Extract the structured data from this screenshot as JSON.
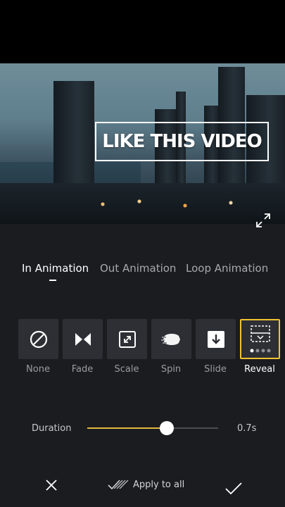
{
  "video": {
    "caption": "LIKE THIS VIDEO"
  },
  "tabs": [
    {
      "label": "In Animation",
      "active": true
    },
    {
      "label": "Out Animation",
      "active": false
    },
    {
      "label": "Loop Animation",
      "active": false
    }
  ],
  "animations": [
    {
      "label": "None",
      "icon": "none-icon",
      "selected": false
    },
    {
      "label": "Fade",
      "icon": "fade-icon",
      "selected": false
    },
    {
      "label": "Scale",
      "icon": "scale-icon",
      "selected": false
    },
    {
      "label": "Spin",
      "icon": "spin-icon",
      "selected": false
    },
    {
      "label": "Slide",
      "icon": "slide-icon",
      "selected": false
    },
    {
      "label": "Reveal",
      "icon": "reveal-icon",
      "selected": true
    }
  ],
  "duration": {
    "label": "Duration",
    "value": "0.7s",
    "fraction": 0.61
  },
  "footer": {
    "apply_label": "Apply to all"
  },
  "colors": {
    "accent": "#e2b83d",
    "selected_border": "#f1c232",
    "background": "#1b1c20"
  }
}
